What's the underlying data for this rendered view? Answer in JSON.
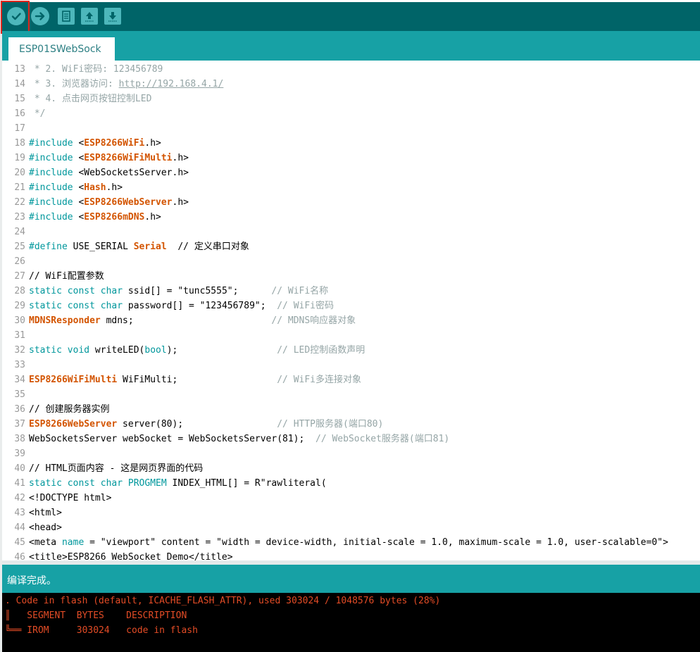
{
  "toolbar": {
    "buttons": [
      {
        "name": "verify",
        "icon": "check-icon"
      },
      {
        "name": "upload",
        "icon": "arrow-right-icon"
      },
      {
        "name": "new",
        "icon": "document-icon"
      },
      {
        "name": "open",
        "icon": "arrow-up-icon"
      },
      {
        "name": "save",
        "icon": "arrow-down-icon"
      }
    ],
    "highlight_color": "#e0251b"
  },
  "tab": {
    "label": "ESP01SWebSock"
  },
  "editor": {
    "lines": [
      {
        "n": "13",
        "t": [
          {
            "c": "comment",
            "v": " * 2. WiFi密码: 123456789"
          }
        ]
      },
      {
        "n": "14",
        "t": [
          {
            "c": "comment",
            "v": " * 3. 浏览器访问: "
          },
          {
            "c": "comment link",
            "v": "http://192.168.4.1/"
          }
        ]
      },
      {
        "n": "15",
        "t": [
          {
            "c": "comment",
            "v": " * 4. 点击网页按钮控制LED"
          }
        ]
      },
      {
        "n": "16",
        "t": [
          {
            "c": "comment",
            "v": " */"
          }
        ]
      },
      {
        "n": "17",
        "t": []
      },
      {
        "n": "18",
        "t": [
          {
            "c": "kw",
            "v": "#include "
          },
          {
            "c": "plain",
            "v": "<"
          },
          {
            "c": "hl",
            "v": "ESP8266WiFi"
          },
          {
            "c": "plain",
            "v": ".h>"
          }
        ]
      },
      {
        "n": "19",
        "t": [
          {
            "c": "kw",
            "v": "#include "
          },
          {
            "c": "plain",
            "v": "<"
          },
          {
            "c": "hl",
            "v": "ESP8266WiFiMulti"
          },
          {
            "c": "plain",
            "v": ".h>"
          }
        ]
      },
      {
        "n": "20",
        "t": [
          {
            "c": "kw",
            "v": "#include "
          },
          {
            "c": "plain",
            "v": "<WebSocketsServer.h>"
          }
        ]
      },
      {
        "n": "21",
        "t": [
          {
            "c": "kw",
            "v": "#include "
          },
          {
            "c": "plain",
            "v": "<"
          },
          {
            "c": "hl",
            "v": "Hash"
          },
          {
            "c": "plain",
            "v": ".h>"
          }
        ]
      },
      {
        "n": "22",
        "t": [
          {
            "c": "kw",
            "v": "#include "
          },
          {
            "c": "plain",
            "v": "<"
          },
          {
            "c": "hl",
            "v": "ESP8266WebServer"
          },
          {
            "c": "plain",
            "v": ".h>"
          }
        ]
      },
      {
        "n": "23",
        "t": [
          {
            "c": "kw",
            "v": "#include "
          },
          {
            "c": "plain",
            "v": "<"
          },
          {
            "c": "hl",
            "v": "ESP8266mDNS"
          },
          {
            "c": "plain",
            "v": ".h>"
          }
        ]
      },
      {
        "n": "24",
        "t": []
      },
      {
        "n": "25",
        "t": [
          {
            "c": "kw",
            "v": "#define "
          },
          {
            "c": "plain",
            "v": "USE_SERIAL "
          },
          {
            "c": "hl",
            "v": "Serial"
          },
          {
            "c": "plain",
            "v": "  // 定义串口对象"
          }
        ]
      },
      {
        "n": "26",
        "t": []
      },
      {
        "n": "27",
        "t": [
          {
            "c": "plain",
            "v": "// WiFi配置参数"
          }
        ]
      },
      {
        "n": "28",
        "t": [
          {
            "c": "kw",
            "v": "static const char "
          },
          {
            "c": "plain",
            "v": "ssid[] = \"tunc5555\";      "
          },
          {
            "c": "comment",
            "v": "// WiFi名称"
          }
        ]
      },
      {
        "n": "29",
        "t": [
          {
            "c": "kw",
            "v": "static const char "
          },
          {
            "c": "plain",
            "v": "password[] = \"123456789\";  "
          },
          {
            "c": "comment",
            "v": "// WiFi密码"
          }
        ]
      },
      {
        "n": "30",
        "t": [
          {
            "c": "hl",
            "v": "MDNSResponder"
          },
          {
            "c": "plain",
            "v": " mdns;                         "
          },
          {
            "c": "comment",
            "v": "// MDNS响应器对象"
          }
        ]
      },
      {
        "n": "31",
        "t": []
      },
      {
        "n": "32",
        "t": [
          {
            "c": "kw",
            "v": "static void "
          },
          {
            "c": "plain",
            "v": "writeLED("
          },
          {
            "c": "kw",
            "v": "bool"
          },
          {
            "c": "plain",
            "v": ");                  "
          },
          {
            "c": "comment",
            "v": "// LED控制函数声明"
          }
        ]
      },
      {
        "n": "33",
        "t": []
      },
      {
        "n": "34",
        "t": [
          {
            "c": "hl",
            "v": "ESP8266WiFiMulti"
          },
          {
            "c": "plain",
            "v": " WiFiMulti;                  "
          },
          {
            "c": "comment",
            "v": "// WiFi多连接对象"
          }
        ]
      },
      {
        "n": "35",
        "t": []
      },
      {
        "n": "36",
        "t": [
          {
            "c": "plain",
            "v": "// 创建服务器实例"
          }
        ]
      },
      {
        "n": "37",
        "t": [
          {
            "c": "hl",
            "v": "ESP8266WebServer"
          },
          {
            "c": "plain",
            "v": " server(80);                 "
          },
          {
            "c": "comment",
            "v": "// HTTP服务器(端口80)"
          }
        ]
      },
      {
        "n": "38",
        "t": [
          {
            "c": "plain",
            "v": "WebSocketsServer webSocket = WebSocketsServer(81);  "
          },
          {
            "c": "comment",
            "v": "// WebSocket服务器(端口81)"
          }
        ]
      },
      {
        "n": "39",
        "t": []
      },
      {
        "n": "40",
        "t": [
          {
            "c": "plain",
            "v": "// HTML页面内容 - 这是网页界面的代码"
          }
        ]
      },
      {
        "n": "41",
        "t": [
          {
            "c": "kw",
            "v": "static const char "
          },
          {
            "c": "kw",
            "v": "PROGMEM"
          },
          {
            "c": "plain",
            "v": " INDEX_HTML[] = R\"rawliteral("
          }
        ]
      },
      {
        "n": "42",
        "t": [
          {
            "c": "plain",
            "v": "<!DOCTYPE html>"
          }
        ]
      },
      {
        "n": "43",
        "t": [
          {
            "c": "plain",
            "v": "<html>"
          }
        ]
      },
      {
        "n": "44",
        "t": [
          {
            "c": "plain",
            "v": "<head>"
          }
        ]
      },
      {
        "n": "45",
        "t": [
          {
            "c": "plain",
            "v": "<meta "
          },
          {
            "c": "kw",
            "v": "name"
          },
          {
            "c": "plain",
            "v": " = \"viewport\" content = \"width = device-width, initial-scale = 1.0, maximum-scale = 1.0, user-scalable=0\">"
          }
        ]
      },
      {
        "n": "46",
        "t": [
          {
            "c": "plain",
            "v": "<title>ESP8266 WebSocket Demo</title>"
          }
        ]
      }
    ],
    "colors": {
      "kw": "#00979c",
      "hl": "#d35400",
      "plain": "#000000",
      "comment": "#95a5a6",
      "number": "#999999"
    }
  },
  "status": {
    "text": "编译完成。"
  },
  "console": {
    "lines": [
      ". Code in flash (default, ICACHE_FLASH_ATTR), used 303024 / 1048576 bytes (28%)",
      "║   SEGMENT  BYTES    DESCRIPTION",
      "╚══ IROM     303024   code in flash"
    ],
    "color": "#e34c26"
  }
}
